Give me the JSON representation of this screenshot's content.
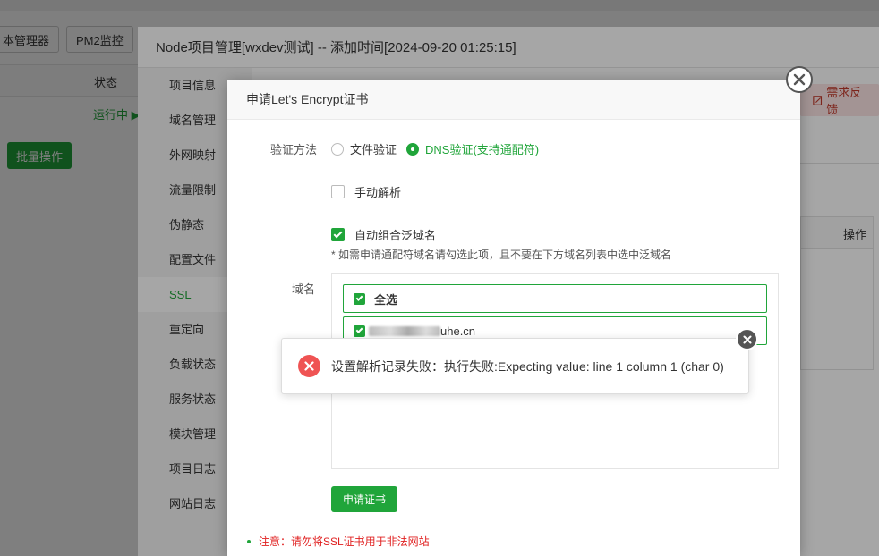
{
  "background": {
    "toolbar_buttons": [
      "本管理器",
      "PM2监控"
    ],
    "table_status_header": "状态",
    "row_status": "运行中 ▶",
    "batch_button": "批量操作"
  },
  "panel": {
    "title": "Node项目管理[wxdev测试] -- 添加时间[2024-09-20 01:25:15]",
    "sidebar": [
      {
        "label": "项目信息"
      },
      {
        "label": "域名管理"
      },
      {
        "label": "外网映射"
      },
      {
        "label": "流量限制"
      },
      {
        "label": "伪静态"
      },
      {
        "label": "配置文件"
      },
      {
        "label": "SSL"
      },
      {
        "label": "重定向"
      },
      {
        "label": "负载状态"
      },
      {
        "label": "服务状态"
      },
      {
        "label": "模块管理"
      },
      {
        "label": "项目日志"
      },
      {
        "label": "网站日志"
      }
    ],
    "active_item": "SSL",
    "feedback_button": "需求反馈",
    "table_op_header": "操作"
  },
  "modal": {
    "title": "申请Let's Encrypt证书",
    "verify_label": "验证方法",
    "verify_options": [
      {
        "label": "文件验证",
        "checked": false
      },
      {
        "label": "DNS验证(支持通配符)",
        "checked": true
      }
    ],
    "manual_dns": {
      "label": "手动解析",
      "checked": false
    },
    "auto_wildcard": {
      "label": "自动组合泛域名",
      "checked": true
    },
    "wildcard_hint": "* 如需申请通配符域名请勾选此项，且不要在下方域名列表中选中泛域名",
    "domain_label": "域名",
    "domains": [
      {
        "label": "全选",
        "checked": true
      },
      {
        "label": "uhe.cn",
        "checked": true
      }
    ],
    "apply_button": "申请证书",
    "note": "注意：请勿将SSL证书用于非法网站"
  },
  "toast": {
    "message": "设置解析记录失败：执行失败:Expecting value: line 1 column 1 (char 0)"
  },
  "colors": {
    "accent": "#20a53a",
    "error": "#ef5353",
    "note": "#e02020"
  }
}
